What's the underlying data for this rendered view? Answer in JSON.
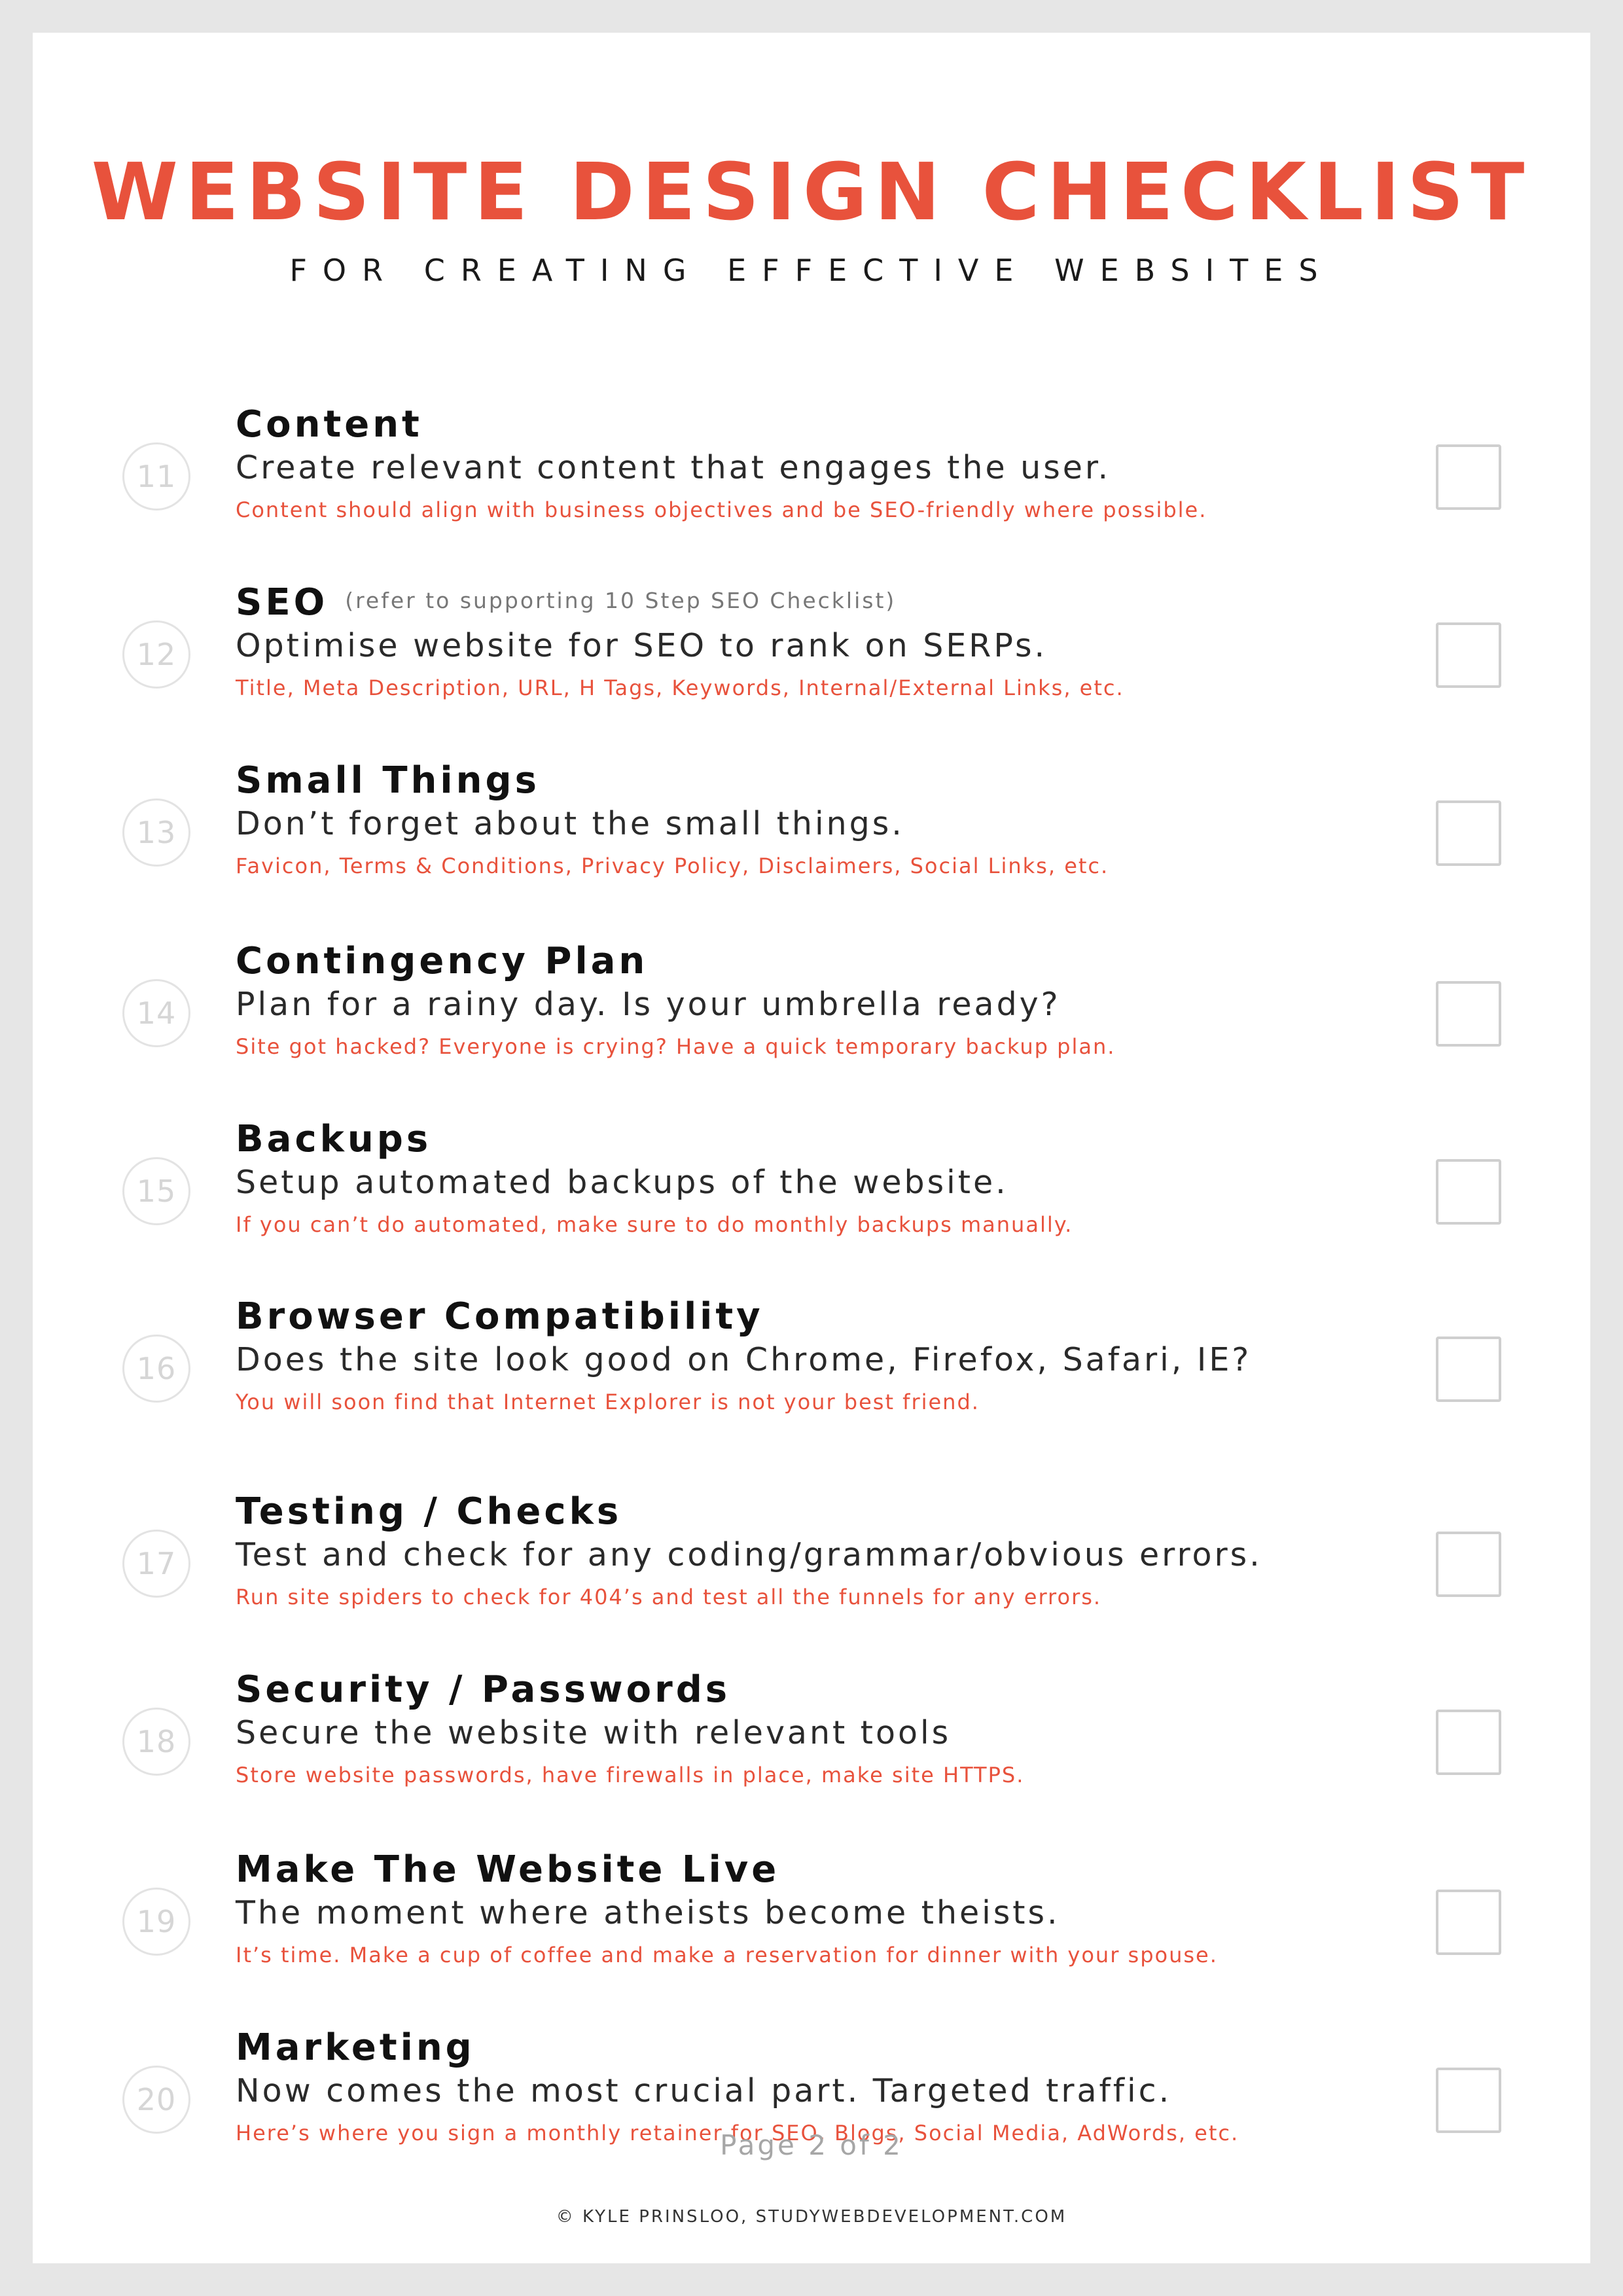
{
  "header": {
    "title": "WEBSITE DESIGN CHECKLIST",
    "subtitle": "FOR CREATING EFFECTIVE WEBSITES"
  },
  "items": [
    {
      "number": "11",
      "title": "Content",
      "note": "",
      "description": "Create relevant content that engages the user.",
      "hint": "Content should align with business objectives and be SEO-friendly where possible."
    },
    {
      "number": "12",
      "title": "SEO",
      "note": "(refer to supporting 10 Step SEO Checklist)",
      "description": "Optimise website for SEO to rank on SERPs.",
      "hint": "Title, Meta Description, URL, H Tags, Keywords, Internal/External Links, etc."
    },
    {
      "number": "13",
      "title": "Small Things",
      "note": "",
      "description": "Don’t forget about the small things.",
      "hint": "Favicon, Terms & Conditions, Privacy Policy, Disclaimers, Social Links, etc."
    },
    {
      "number": "14",
      "title": "Contingency Plan",
      "note": "",
      "description": "Plan for a rainy day. Is your umbrella ready?",
      "hint": "Site got hacked? Everyone is crying? Have a quick temporary backup plan."
    },
    {
      "number": "15",
      "title": "Backups",
      "note": "",
      "description": "Setup automated backups of the website.",
      "hint": "If you can’t do automated, make sure to do monthly backups manually."
    },
    {
      "number": "16",
      "title": "Browser Compatibility",
      "note": "",
      "description": "Does the site look good on Chrome, Firefox, Safari, IE?",
      "hint": "You will soon find that Internet Explorer is not your best friend."
    },
    {
      "number": "17",
      "title": "Testing / Checks",
      "note": "",
      "description": "Test and check for any coding/grammar/obvious errors.",
      "hint": "Run site spiders to check for 404’s and test all the funnels for any errors."
    },
    {
      "number": "18",
      "title": "Security / Passwords",
      "note": "",
      "description": "Secure the website with relevant tools",
      "hint": "Store website passwords, have firewalls in place, make site HTTPS."
    },
    {
      "number": "19",
      "title": "Make The Website Live",
      "note": "",
      "description": "The moment where atheists become theists.",
      "hint": "It’s time. Make a cup of coffee and make a reservation for dinner with your spouse."
    },
    {
      "number": "20",
      "title": "Marketing",
      "note": "",
      "description": "Now comes the most crucial part. Targeted traffic.",
      "hint": "Here’s where you sign a monthly retainer for SEO, Blogs, Social Media, AdWords, etc."
    }
  ],
  "footer": {
    "page_indicator": "Page 2 of 2",
    "copyright": "© KYLE PRINSLOO, STUDYWEBDEVELOPMENT.COM"
  },
  "colors": {
    "accent": "#e8523c",
    "text": "#111111",
    "muted": "#a6a6a6",
    "checkbox_border": "#cfcfcf"
  }
}
